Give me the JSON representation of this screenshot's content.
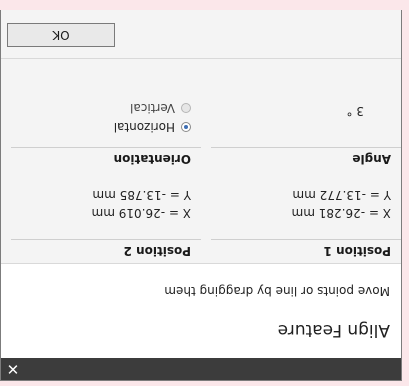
{
  "window": {
    "close_label": "✕"
  },
  "header": {
    "title": "Align Feature",
    "subtitle": "Move points or line by dragging them"
  },
  "position1": {
    "title": "Position 1",
    "x": "X = -26.281 mm",
    "y": "Y = -13.772 mm"
  },
  "position2": {
    "title": "Position 2",
    "x": "X = -26.019 mm",
    "y": "Y = -13.785 mm"
  },
  "angle": {
    "title": "Angle",
    "value": "3 °"
  },
  "orientation": {
    "title": "Orientation",
    "options": [
      {
        "label": "Horizontal",
        "checked": true
      },
      {
        "label": "Vertical",
        "checked": false
      }
    ]
  },
  "footer": {
    "ok_label": "OK"
  },
  "colors": {
    "titlebar": "#3c3c3c",
    "radio_accent": "#3f6fb4",
    "background": "#f4f4f4"
  }
}
